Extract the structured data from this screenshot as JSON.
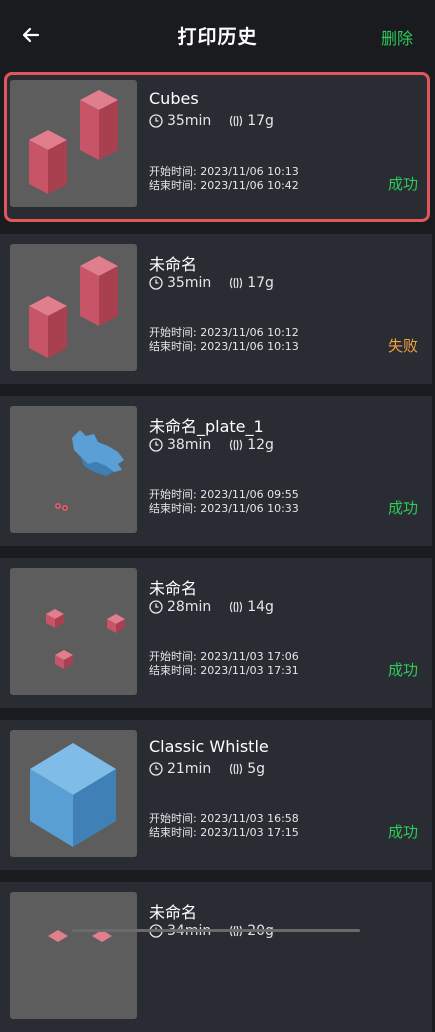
{
  "header": {
    "title": "打印历史",
    "delete_label": "删除"
  },
  "items": [
    {
      "name": "Cubes",
      "duration": "35min",
      "filament": "17g",
      "start_time": "开始时间: 2023/11/06  10:13",
      "end_time": "结束时间: 2023/11/06  10:42",
      "status": "成功"
    },
    {
      "name": "未命名",
      "duration": "35min",
      "filament": "17g",
      "start_time": "开始时间: 2023/11/06  10:12",
      "end_time": "结束时间: 2023/11/06  10:13",
      "status": "失败"
    },
    {
      "name": "未命名_plate_1",
      "duration": "38min",
      "filament": "12g",
      "start_time": "开始时间: 2023/11/06  09:55",
      "end_time": "结束时间: 2023/11/06  10:33",
      "status": "成功"
    },
    {
      "name": "未命名",
      "duration": "28min",
      "filament": "14g",
      "start_time": "开始时间: 2023/11/03  17:06",
      "end_time": "结束时间: 2023/11/03  17:31",
      "status": "成功"
    },
    {
      "name": "Classic Whistle",
      "duration": "21min",
      "filament": "5g",
      "start_time": "开始时间: 2023/11/03  16:58",
      "end_time": "结束时间: 2023/11/03  17:15",
      "status": "成功"
    },
    {
      "name": "未命名",
      "duration": "34min",
      "filament": "20g"
    }
  ],
  "colors": {
    "success": "#2ecb58",
    "failed": "#f3a23b",
    "selected_border": "#e0565a"
  },
  "icons": {
    "clock": "clock-icon",
    "filament": "filament-icon",
    "back": "back-arrow-icon"
  }
}
